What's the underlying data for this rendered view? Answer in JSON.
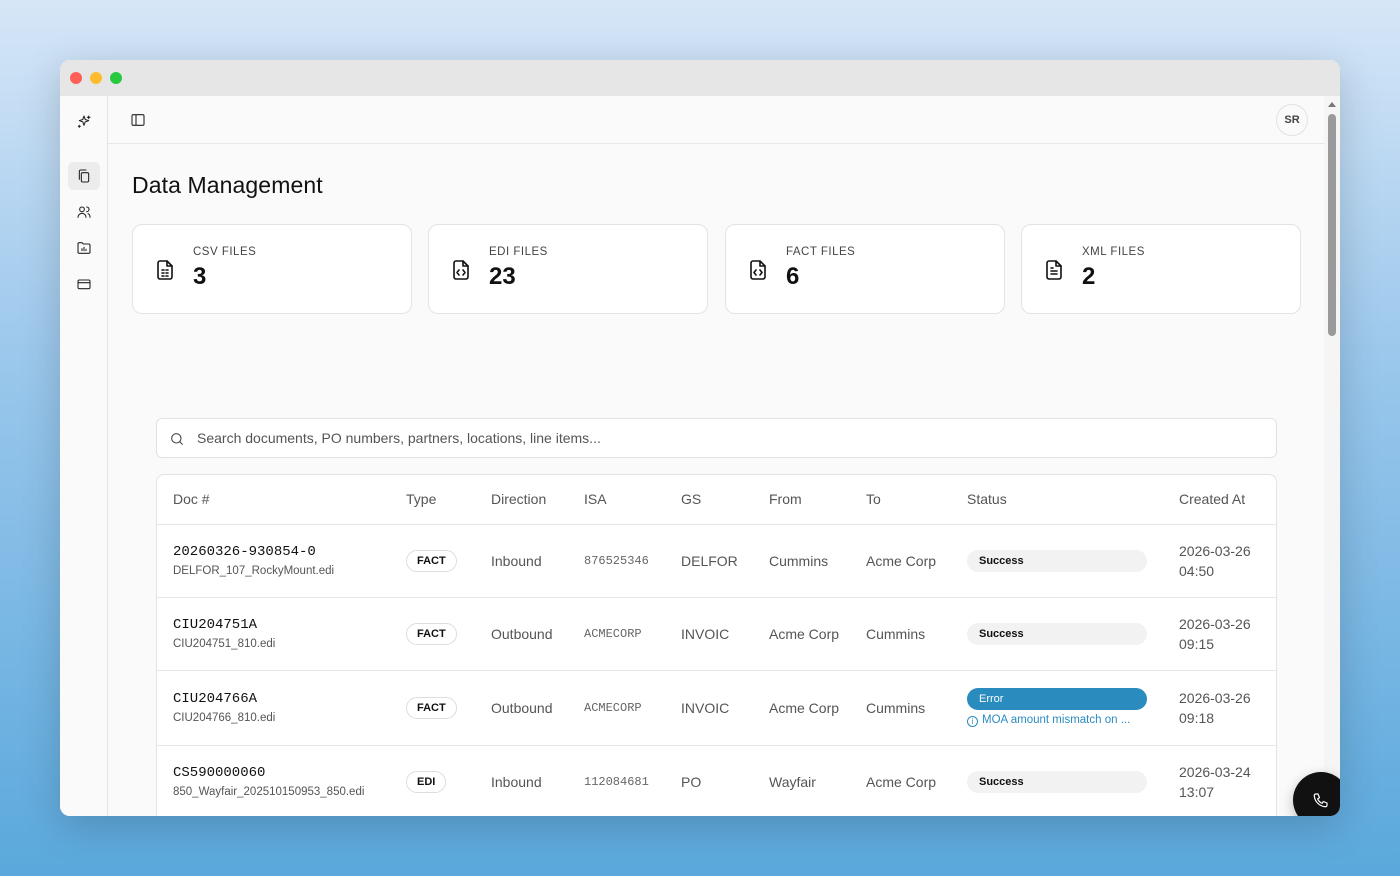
{
  "header": {
    "avatar_initials": "SR"
  },
  "sidebar": {
    "items": [
      {
        "icon": "sparkle-icon",
        "active": false
      },
      {
        "icon": "documents-icon",
        "active": true
      },
      {
        "icon": "users-icon",
        "active": false
      },
      {
        "icon": "folder-chart-icon",
        "active": false
      },
      {
        "icon": "credit-card-icon",
        "active": false
      }
    ]
  },
  "page": {
    "title": "Data Management"
  },
  "stats": [
    {
      "label": "CSV FILES",
      "value": "3",
      "icon": "csv-file-icon"
    },
    {
      "label": "EDI FILES",
      "value": "23",
      "icon": "code-file-icon"
    },
    {
      "label": "FACT FILES",
      "value": "6",
      "icon": "code-file-icon"
    },
    {
      "label": "XML FILES",
      "value": "2",
      "icon": "text-file-icon"
    }
  ],
  "search": {
    "placeholder": "Search documents, PO numbers, partners, locations, line items...",
    "value": ""
  },
  "table": {
    "columns": [
      "Doc #",
      "Type",
      "Direction",
      "ISA",
      "GS",
      "From",
      "To",
      "Status",
      "Created At"
    ],
    "rows": [
      {
        "doc_number": "20260326-930854-0",
        "file_name": "DELFOR_107_RockyMount.edi",
        "type": "FACT",
        "direction": "Inbound",
        "isa": "876525346",
        "gs": "DELFOR",
        "from": "Cummins",
        "to": "Acme Corp",
        "status": "Success",
        "status_message": "",
        "created_date": "2026-03-26",
        "created_time": "04:50"
      },
      {
        "doc_number": "CIU204751A",
        "file_name": "CIU204751_810.edi",
        "type": "FACT",
        "direction": "Outbound",
        "isa": "ACMECORP",
        "gs": "INVOIC",
        "from": "Acme Corp",
        "to": "Cummins",
        "status": "Success",
        "status_message": "",
        "created_date": "2026-03-26",
        "created_time": "09:15"
      },
      {
        "doc_number": "CIU204766A",
        "file_name": "CIU204766_810.edi",
        "type": "FACT",
        "direction": "Outbound",
        "isa": "ACMECORP",
        "gs": "INVOIC",
        "from": "Acme Corp",
        "to": "Cummins",
        "status": "Error",
        "status_message": "MOA amount mismatch on ...",
        "created_date": "2026-03-26",
        "created_time": "09:18"
      },
      {
        "doc_number": "CS590000060",
        "file_name": "850_Wayfair_202510150953_850.edi",
        "type": "EDI",
        "direction": "Inbound",
        "isa": "112084681",
        "gs": "PO",
        "from": "Wayfair",
        "to": "Acme Corp",
        "status": "Success",
        "status_message": "",
        "created_date": "2026-03-24",
        "created_time": "13:07"
      }
    ]
  },
  "colors": {
    "error": "#2a8bbf",
    "success_bg": "#f2f2f2",
    "fab": "#111111"
  },
  "fab": {
    "icon": "phone-icon"
  }
}
